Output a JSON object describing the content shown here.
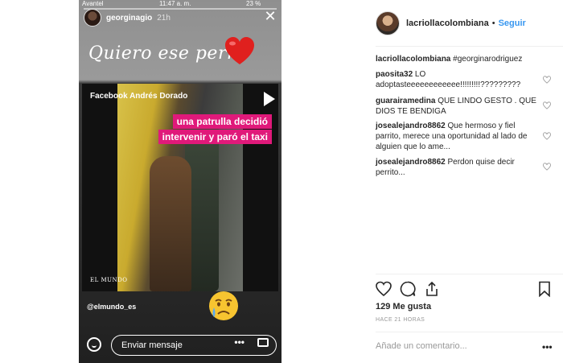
{
  "story": {
    "status": {
      "carrier": "Avantel",
      "time": "11:47 a. m.",
      "battery": "23 %"
    },
    "username": "georginagio",
    "age": "21h",
    "caption": "Quiero ese perro",
    "video": {
      "source_label": "Facebook Andrés Dorado",
      "banner_line1": "una patrulla decidió",
      "banner_line2": "intervenir y paró el taxi",
      "publisher": "EL MUNDO"
    },
    "handle": "@elmundo_es",
    "message_placeholder": "Enviar mensaje",
    "more": "•••"
  },
  "post": {
    "username": "lacriollacolombiana",
    "separator": "•",
    "follow_label": "Seguir",
    "caption": {
      "user": "lacriollacolombiana",
      "text": "#georginarodriguez"
    },
    "comments": [
      {
        "user": "paosita32",
        "text": "LO adoptasteeeeeeeeeeee!!!!!!!!!?????????"
      },
      {
        "user": "guarairamedina",
        "text": "QUE LINDO GESTO . QUE DIOS TE BENDIGA"
      },
      {
        "user": "josealejandro8862",
        "text": "Que hermoso y fiel parrito, merece una oportunidad al lado de alguien que lo ame..."
      },
      {
        "user": "josealejandro8862",
        "text": "Perdon quise decir perrito..."
      }
    ],
    "likes": "129 Me gusta",
    "timestamp": "HACE 21 HORAS",
    "add_comment_placeholder": "Añade un comentario...",
    "more": "•••"
  },
  "colors": {
    "accent": "#3897f0",
    "banner": "#e0197a",
    "heart": "#e0201e"
  }
}
